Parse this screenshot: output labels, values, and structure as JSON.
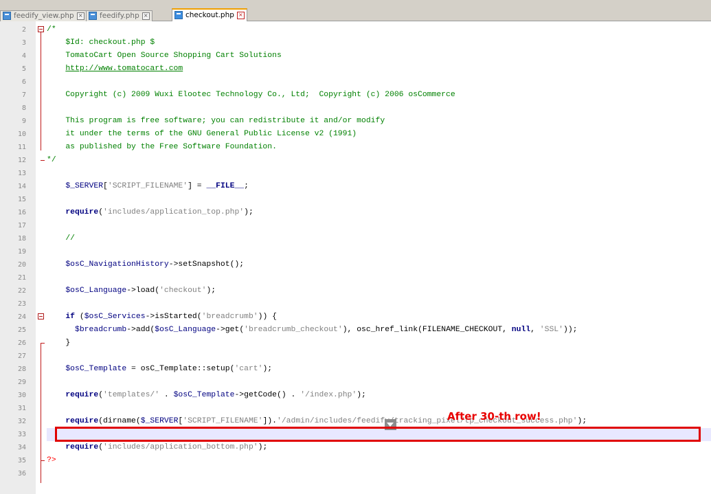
{
  "tabs": [
    {
      "label": "feedify_view.php",
      "active": false
    },
    {
      "label": "feedify.php",
      "active": false
    },
    {
      "label": "checkout.php",
      "active": true
    }
  ],
  "editor": {
    "line_numbers": [
      "2",
      "3",
      "4",
      "5",
      "6",
      "7",
      "8",
      "9",
      "10",
      "11",
      "12",
      "13",
      "14",
      "15",
      "16",
      "17",
      "18",
      "19",
      "20",
      "21",
      "22",
      "23",
      "24",
      "25",
      "26",
      "27",
      "28",
      "29",
      "30",
      "31",
      "32",
      "33",
      "34",
      "35",
      "36"
    ],
    "l2_comment_open": "/*",
    "l3_id": "$Id: checkout.php $",
    "l4_title": "TomatoCart Open Source Shopping Cart Solutions",
    "l5_url": "http://www.tomatocart.com",
    "l7_copyright": "Copyright (c) 2009 Wuxi Elootec Technology Co., Ltd;  Copyright (c) 2006 osCommerce",
    "l9_license1": "This program is free software; you can redistribute it and/or modify",
    "l10_license2": "it under the terms of the GNU General Public License v2 (1991)",
    "l11_license3": "as published by the Free Software Foundation.",
    "l12_comment_close": "*/",
    "l14_var": "$_SERVER",
    "l14_open": "[",
    "l14_key": "'SCRIPT_FILENAME'",
    "l14_close": "]",
    "l14_assign": " = ",
    "l14_const": "__FILE__",
    "l14_semi": ";",
    "l16_kw": "require",
    "l16_open": "(",
    "l16_str": "'includes/application_top.php'",
    "l16_close": ");",
    "l18_comment": "//",
    "l20_var": "$osC_NavigationHistory",
    "l20_arrow": "->",
    "l20_fn": "setSnapshot",
    "l20_end": "();",
    "l22_var": "$osC_Language",
    "l22_arrow": "->",
    "l22_fn": "load",
    "l22_open": "(",
    "l22_str": "'checkout'",
    "l22_close": ");",
    "l24_kw": "if",
    "l24_open": " (",
    "l24_var": "$osC_Services",
    "l24_arrow": "->",
    "l24_fn": "isStarted",
    "l24_open2": "(",
    "l24_str": "'breadcrumb'",
    "l24_close": ")) {",
    "l25_indent": "  ",
    "l25_var": "$breadcrumb",
    "l25_arrow": "->",
    "l25_fn": "add",
    "l25_open": "(",
    "l25_var2": "$osC_Language",
    "l25_arrow2": "->",
    "l25_fn2": "get",
    "l25_open2": "(",
    "l25_str": "'breadcrumb_checkout'",
    "l25_mid": "), osc_href_link(FILENAME_CHECKOUT, ",
    "l25_null": "null",
    "l25_comma": ", ",
    "l25_ssl": "'SSL'",
    "l25_end": "));",
    "l26_brace": "}",
    "l28_var": "$osC_Template",
    "l28_assign": " = osC_Template::setup(",
    "l28_str": "'cart'",
    "l28_end": ");",
    "l30_kw": "require",
    "l30_open": "(",
    "l30_str": "'templates/'",
    "l30_dot": " . ",
    "l30_var": "$osC_Template",
    "l30_arrow": "->",
    "l30_fn": "getCode",
    "l30_call": "() . ",
    "l30_str2": "'/index.php'",
    "l30_end": ");",
    "l32_kw": "require",
    "l32_open": "(dirname(",
    "l32_var": "$_SERVER",
    "l32_br": "[",
    "l32_key": "'SCRIPT_FILENAME'",
    "l32_br2": "]).",
    "l32_str": "'/admin/includes/feedify/tracking_pixel/tp_checkout_success.php'",
    "l32_end": ");",
    "l34_kw": "require",
    "l34_open": "(",
    "l34_str": "'includes/application_bottom.php'",
    "l34_end": ");",
    "l35_tag": "?>"
  },
  "annotation": {
    "text": "After 30-th row!"
  },
  "colors": {
    "highlight_border": "#e00000",
    "annotation": "#e80000",
    "keyword": "#000080",
    "comment": "#008000",
    "string": "#808080"
  }
}
